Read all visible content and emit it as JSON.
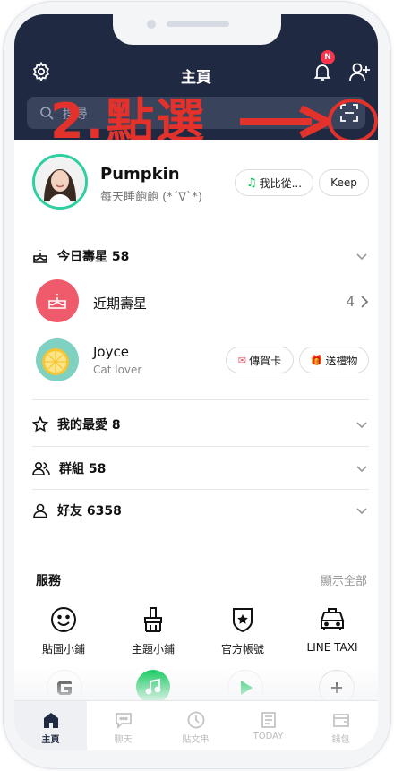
{
  "header": {
    "title": "主頁",
    "notification_badge": "N",
    "search_placeholder": "搜尋",
    "colors": {
      "header_bg": "#1f2942",
      "badge": "#ff334b"
    }
  },
  "annotation": {
    "text": "2.點選",
    "color": "#e3322b",
    "target": "qr-scan-icon"
  },
  "profile": {
    "name": "Pumpkin",
    "status": "每天睡飽飽 (*´∇`*)",
    "music_button": "我比從...",
    "keep_button": "Keep"
  },
  "birthdays": {
    "today_label": "今日壽星 58",
    "recent_label": "近期壽星",
    "recent_count": "4"
  },
  "friend": {
    "name": "Joyce",
    "status": "Cat lover",
    "card_button": "傳賀卡",
    "gift_button": "送禮物"
  },
  "sections": {
    "favorites": "我的最愛  8",
    "groups": "群組  58",
    "friends": "好友  6358"
  },
  "services": {
    "title": "服務",
    "show_all": "顯示全部",
    "items": [
      "貼圖小鋪",
      "主題小鋪",
      "官方帳號",
      "LINE TAXI"
    ]
  },
  "tabs": [
    "主頁",
    "聊天",
    "貼文串",
    "TODAY",
    "錢包"
  ]
}
